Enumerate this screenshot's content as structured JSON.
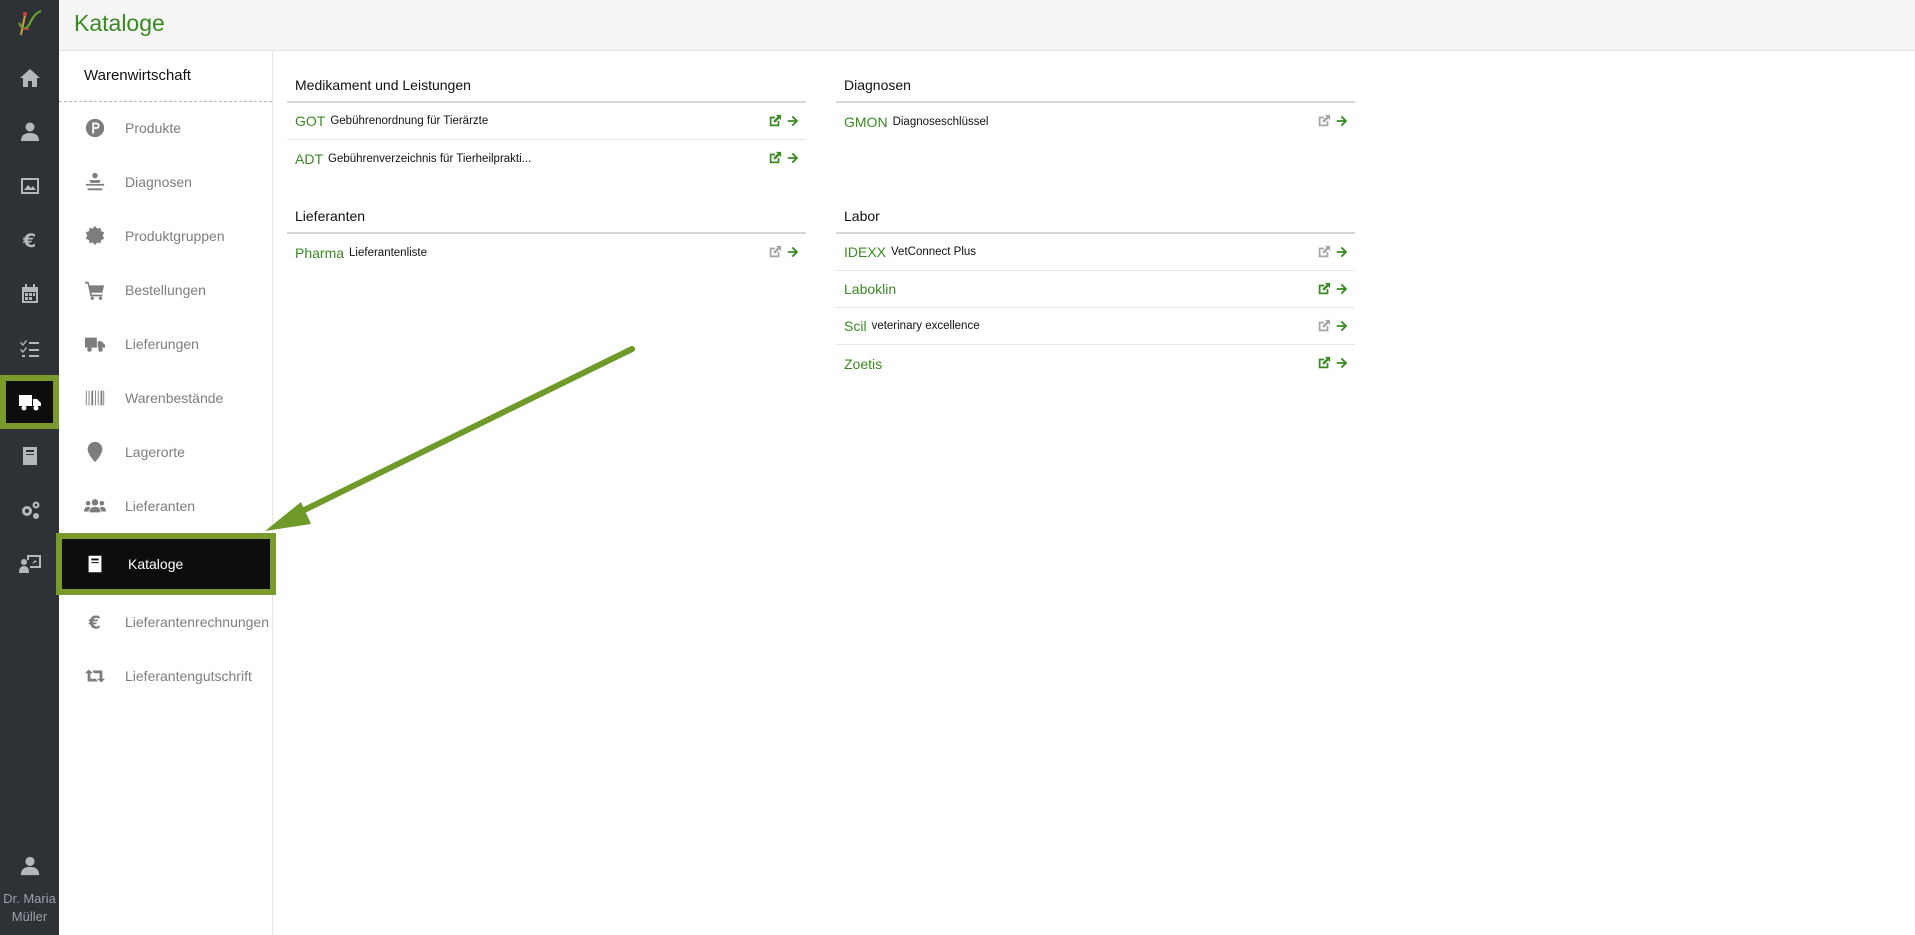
{
  "header": {
    "title": "Kataloge"
  },
  "rail": {
    "items": [
      {
        "icon": "home-icon"
      },
      {
        "icon": "patient-icon"
      },
      {
        "icon": "image-icon"
      },
      {
        "icon": "euro-icon"
      },
      {
        "icon": "calendar-icon"
      },
      {
        "icon": "checklist-icon"
      },
      {
        "icon": "truck-icon",
        "active": true
      },
      {
        "icon": "book-icon"
      },
      {
        "icon": "settings-icon"
      },
      {
        "icon": "presentation-icon"
      }
    ],
    "user": {
      "line1": "Dr. Maria",
      "line2": "Müller"
    }
  },
  "subnav": {
    "title": "Warenwirtschaft",
    "items": [
      {
        "label": "Produkte",
        "icon": "parking-p-icon"
      },
      {
        "label": "Diagnosen",
        "icon": "diagnosis-icon"
      },
      {
        "label": "Produktgruppen",
        "icon": "badge-icon"
      },
      {
        "label": "Bestellungen",
        "icon": "cart-icon"
      },
      {
        "label": "Lieferungen",
        "icon": "truck-icon"
      },
      {
        "label": "Warenbestände",
        "icon": "barcode-icon"
      },
      {
        "label": "Lagerorte",
        "icon": "map-marker-icon"
      },
      {
        "label": "Lieferanten",
        "icon": "users-icon"
      },
      {
        "label": "Kataloge",
        "icon": "book-icon",
        "active": true
      },
      {
        "label": "Lieferantenrechnungen",
        "icon": "euro-icon"
      },
      {
        "label": "Lieferantengutschrift",
        "icon": "retweet-icon"
      }
    ]
  },
  "sections": {
    "medikament": {
      "title": "Medikament und Leistungen",
      "rows": [
        {
          "name": "GOT",
          "desc": "Gebührenordnung für Tierärzte",
          "ext_active": true
        },
        {
          "name": "ADT",
          "desc": "Gebührenverzeichnis für Tierheilprakti...",
          "ext_active": true
        }
      ]
    },
    "diagnosen": {
      "title": "Diagnosen",
      "rows": [
        {
          "name": "GMON",
          "desc": "Diagnoseschlüssel",
          "ext_active": false
        }
      ]
    },
    "lieferanten": {
      "title": "Lieferanten",
      "rows": [
        {
          "name": "Pharma",
          "desc": "Lieferantenliste",
          "ext_active": false
        }
      ]
    },
    "labor": {
      "title": "Labor",
      "rows": [
        {
          "name": "IDEXX",
          "desc": "VetConnect Plus",
          "ext_active": false
        },
        {
          "name": "Laboklin",
          "desc": "",
          "ext_active": true
        },
        {
          "name": "Scil",
          "desc": "veterinary excellence",
          "ext_active": false
        },
        {
          "name": "Zoetis",
          "desc": "",
          "ext_active": true
        }
      ]
    }
  },
  "colors": {
    "accent": "#3a8a23",
    "highlight": "#7a9a2e",
    "rail": "#2e3236"
  }
}
